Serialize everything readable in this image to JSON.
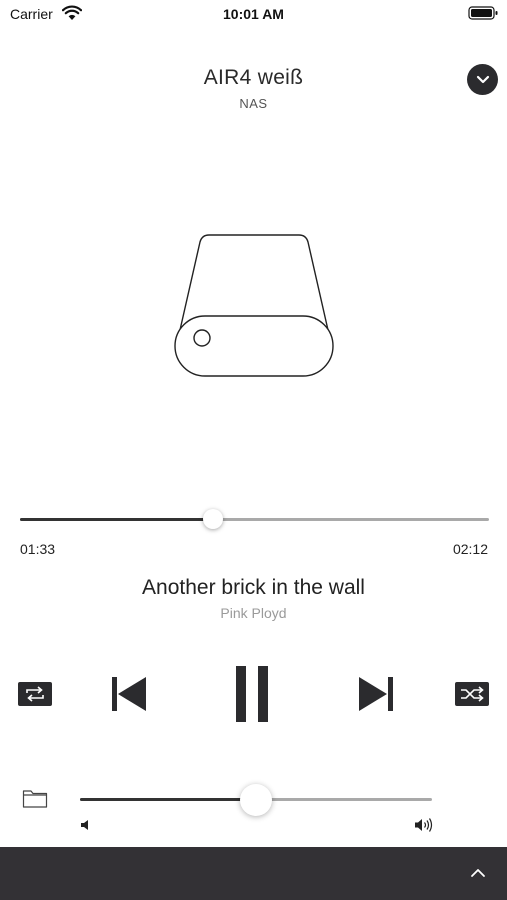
{
  "status_bar": {
    "carrier": "Carrier",
    "time": "10:01 AM"
  },
  "header": {
    "device_name": "AIR4 weiß",
    "source": "NAS",
    "collapse_icon": "chevron-down-icon"
  },
  "artwork": {
    "icon": "nas-drive-icon"
  },
  "playback": {
    "elapsed": "01:33",
    "total": "02:12",
    "progress_fraction": 0.411
  },
  "track": {
    "title": "Another brick in the wall",
    "artist": "Pink Ployd"
  },
  "controls": {
    "repeat_icon": "repeat-icon",
    "previous_icon": "skip-previous-icon",
    "pause_icon": "pause-icon",
    "next_icon": "skip-next-icon",
    "shuffle_icon": "shuffle-icon"
  },
  "volume": {
    "level_fraction": 0.5,
    "browse_icon": "folder-icon",
    "low_icon": "speaker-low-icon",
    "high_icon": "speaker-high-icon"
  },
  "bottom_bar": {
    "expand_icon": "chevron-up-icon",
    "background": "#333135"
  },
  "colors": {
    "accent_dark": "#2b2b2e",
    "track_fill": "#333333",
    "track_rest": "#a9a9a9",
    "artist_text": "#9a9a9a"
  }
}
